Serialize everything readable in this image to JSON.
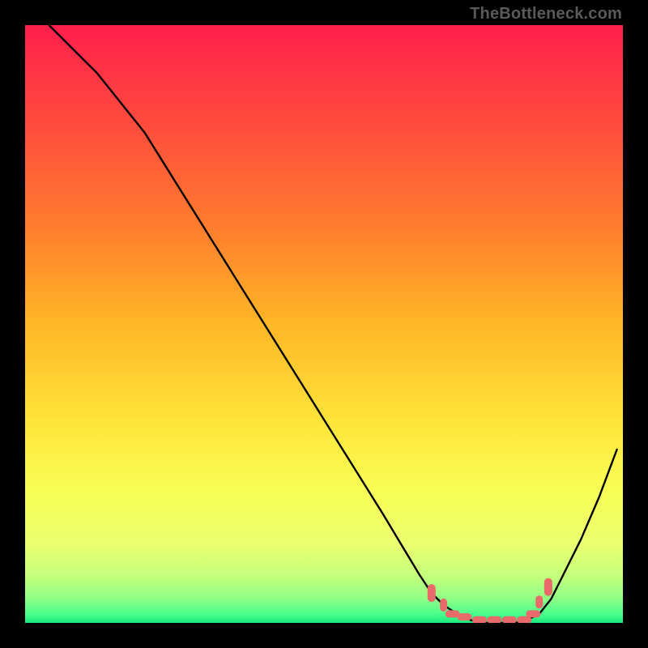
{
  "watermark": "TheBottleneck.com",
  "gradient": {
    "stops": [
      {
        "offset": 0.0,
        "color": "#ff1f4c"
      },
      {
        "offset": 0.16,
        "color": "#ff4a3e"
      },
      {
        "offset": 0.33,
        "color": "#ff7a2e"
      },
      {
        "offset": 0.5,
        "color": "#ffb726"
      },
      {
        "offset": 0.67,
        "color": "#ffe63a"
      },
      {
        "offset": 0.78,
        "color": "#f8ff55"
      },
      {
        "offset": 0.87,
        "color": "#e9ff70"
      },
      {
        "offset": 0.92,
        "color": "#c6ff7b"
      },
      {
        "offset": 0.96,
        "color": "#8fff86"
      },
      {
        "offset": 0.985,
        "color": "#4bff8d"
      },
      {
        "offset": 1.0,
        "color": "#19e87a"
      }
    ]
  },
  "chart_data": {
    "type": "line",
    "title": "",
    "xlabel": "",
    "ylabel": "",
    "xlim": [
      0,
      100
    ],
    "ylim": [
      0,
      100
    ],
    "grid": false,
    "legend": false,
    "series": [
      {
        "name": "bottleneck-curve",
        "x": [
          4,
          6,
          8,
          10,
          12,
          16,
          20,
          25,
          30,
          35,
          40,
          45,
          50,
          55,
          60,
          63,
          66,
          68,
          70,
          73,
          76,
          79,
          82,
          84,
          86,
          88,
          90,
          93,
          96,
          99
        ],
        "y": [
          100,
          98,
          96,
          94,
          92,
          87,
          82,
          74,
          66,
          58,
          50,
          42,
          34,
          26,
          18,
          13,
          8,
          5,
          3,
          1,
          0,
          0,
          0,
          0.5,
          1.5,
          4,
          8,
          14,
          21,
          29
        ]
      }
    ],
    "markers": {
      "name": "sweet-spot-points",
      "color": "#e86a6a",
      "x": [
        68,
        70,
        71.5,
        73.5,
        76,
        78.5,
        81,
        83.5,
        85,
        86,
        87.5
      ],
      "y": [
        5,
        3,
        1.5,
        1,
        0.5,
        0.5,
        0.5,
        0.5,
        1.5,
        3.5,
        6
      ]
    }
  }
}
